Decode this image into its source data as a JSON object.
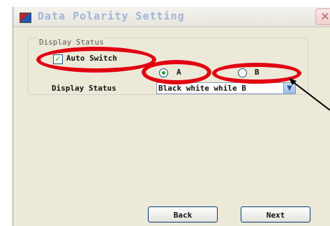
{
  "window": {
    "title": "Data Polarity Setting",
    "close_icon": "close-icon"
  },
  "group": {
    "legend": "Display Status"
  },
  "auto_switch": {
    "label": "Auto Switch",
    "checked": true
  },
  "radios": [
    {
      "label": "A",
      "selected": true
    },
    {
      "label": "B",
      "selected": false
    }
  ],
  "display_status": {
    "label": "Display Status",
    "value": "Black white while B"
  },
  "buttons": {
    "back": "Back",
    "next": "Next"
  },
  "colors": {
    "annotation": "#e10010",
    "accent_check": "#21a121"
  }
}
